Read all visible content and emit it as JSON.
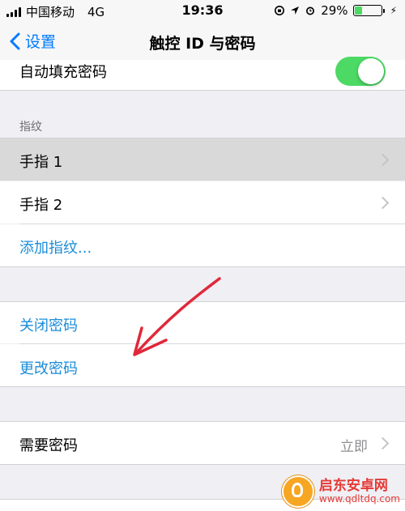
{
  "status_bar": {
    "carrier": "中国移动",
    "network": "4G",
    "time": "19:36",
    "battery": "29%",
    "battery_level": 0.29
  },
  "nav": {
    "back_label": "设置",
    "title": "触控 ID 与密码"
  },
  "autofill": {
    "label": "自动填充密码",
    "enabled": true
  },
  "fingerprint_section": {
    "header": "指纹",
    "items": [
      {
        "label": "手指 1"
      },
      {
        "label": "手指 2"
      }
    ],
    "add_label": "添加指纹..."
  },
  "passcode_section": {
    "turn_off_label": "关闭密码",
    "change_label": "更改密码"
  },
  "require_passcode": {
    "label": "需要密码",
    "value": "立即"
  },
  "watermark": {
    "name": "启东安卓网",
    "url": "www.qdltdq.com"
  },
  "colors": {
    "accent": "#007aff",
    "link": "#1a8cd8",
    "toggle_on": "#4cd964",
    "arrow": "#e0283a"
  }
}
